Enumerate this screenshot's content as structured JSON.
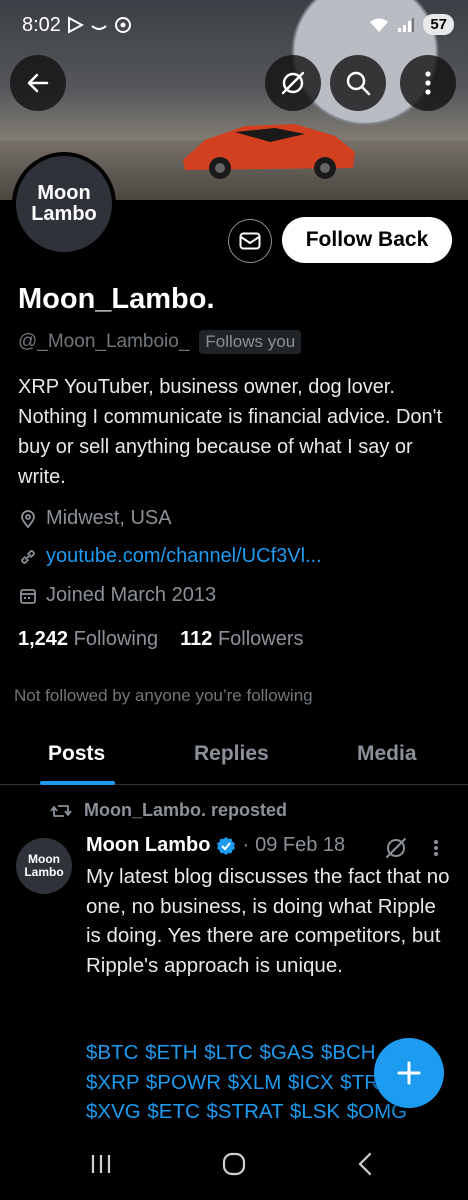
{
  "status_bar": {
    "time": "8:02",
    "battery": "57",
    "icons": [
      "play-icon",
      "link-icon",
      "dnd-icon",
      "wifi-icon",
      "signal-icon",
      "battery-icon"
    ]
  },
  "header_actions": [
    "back-icon",
    "grok-icon",
    "search-icon",
    "more-icon"
  ],
  "profile": {
    "avatar_text_1": "Moon",
    "avatar_text_2": "Lambo",
    "follow_button": "Follow Back",
    "display_name": "Moon_Lambo.",
    "handle": "@_Moon_Lamboio_",
    "follows_you": "Follows you",
    "bio": "XRP YouTuber, business owner, dog lover. Nothing I communicate is financial advice. Don't buy or sell anything because of what I say or write.",
    "location": "Midwest, USA",
    "website": "youtube.com/channel/UCf3Vl...",
    "joined": "Joined March 2013",
    "following_count": "1,242",
    "following_label": "Following",
    "followers_count": "112",
    "followers_label": "Followers",
    "not_followed_note": "Not followed by anyone you’re following"
  },
  "tabs": [
    {
      "label": "Posts",
      "active": true
    },
    {
      "label": "Replies",
      "active": false
    },
    {
      "label": "Media",
      "active": false
    }
  ],
  "post": {
    "repost_label": "Moon_Lambo. reposted",
    "avatar_text_1": "Moon",
    "avatar_text_2": "Lambo",
    "author": "Moon Lambo",
    "separator": "·",
    "date": "09 Feb 18",
    "text": "My latest blog discusses the fact that no one, no business, is doing what Ripple is doing. Yes there are competitors, but Ripple's approach is unique.",
    "cashtags_1": "$BTC $ETH $LTC $GAS $BCH",
    "cashtags_2": "$XRP $POWR $XLM $ICX $TRX",
    "cashtags_3": "$XVG $ETC $STRAT $LSK $OMG"
  },
  "colors": {
    "accent": "#1d9bf0",
    "background": "#000000",
    "muted_text": "#8b9198"
  }
}
